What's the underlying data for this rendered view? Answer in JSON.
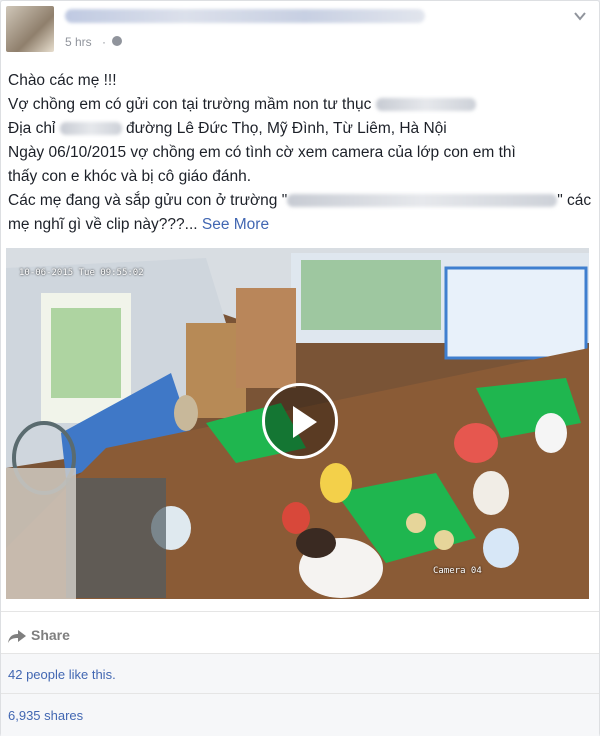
{
  "post": {
    "time": "5 hrs",
    "separator": "·",
    "lines": [
      "Chào các mẹ !!!",
      "Vợ chồng em có gửi con tại trường mầm non tư thục",
      "Địa chỉ",
      "đường Lê Đức Thọ, Mỹ Đình, Từ Liêm, Hà Nội",
      "Ngày 06/10/2015 vợ chồng em có tình cờ xem camera của lớp con em thì",
      "thấy con e khóc và bị cô giáo đánh.",
      "Các mẹ đang và sắp gửu con ở trường \"",
      "\" các",
      "mẹ nghĩ gì về clip này???...",
      "See More"
    ]
  },
  "video": {
    "timestamp": "10-06-2015 Tue 09:55:02",
    "camera_label": "Camera 04"
  },
  "actions": {
    "share": "Share"
  },
  "stats": {
    "likes": "42 people like this.",
    "shares": "6,935 shares"
  },
  "colors": {
    "link": "#4267b2",
    "text": "#1d2129",
    "meta": "#90949c"
  }
}
